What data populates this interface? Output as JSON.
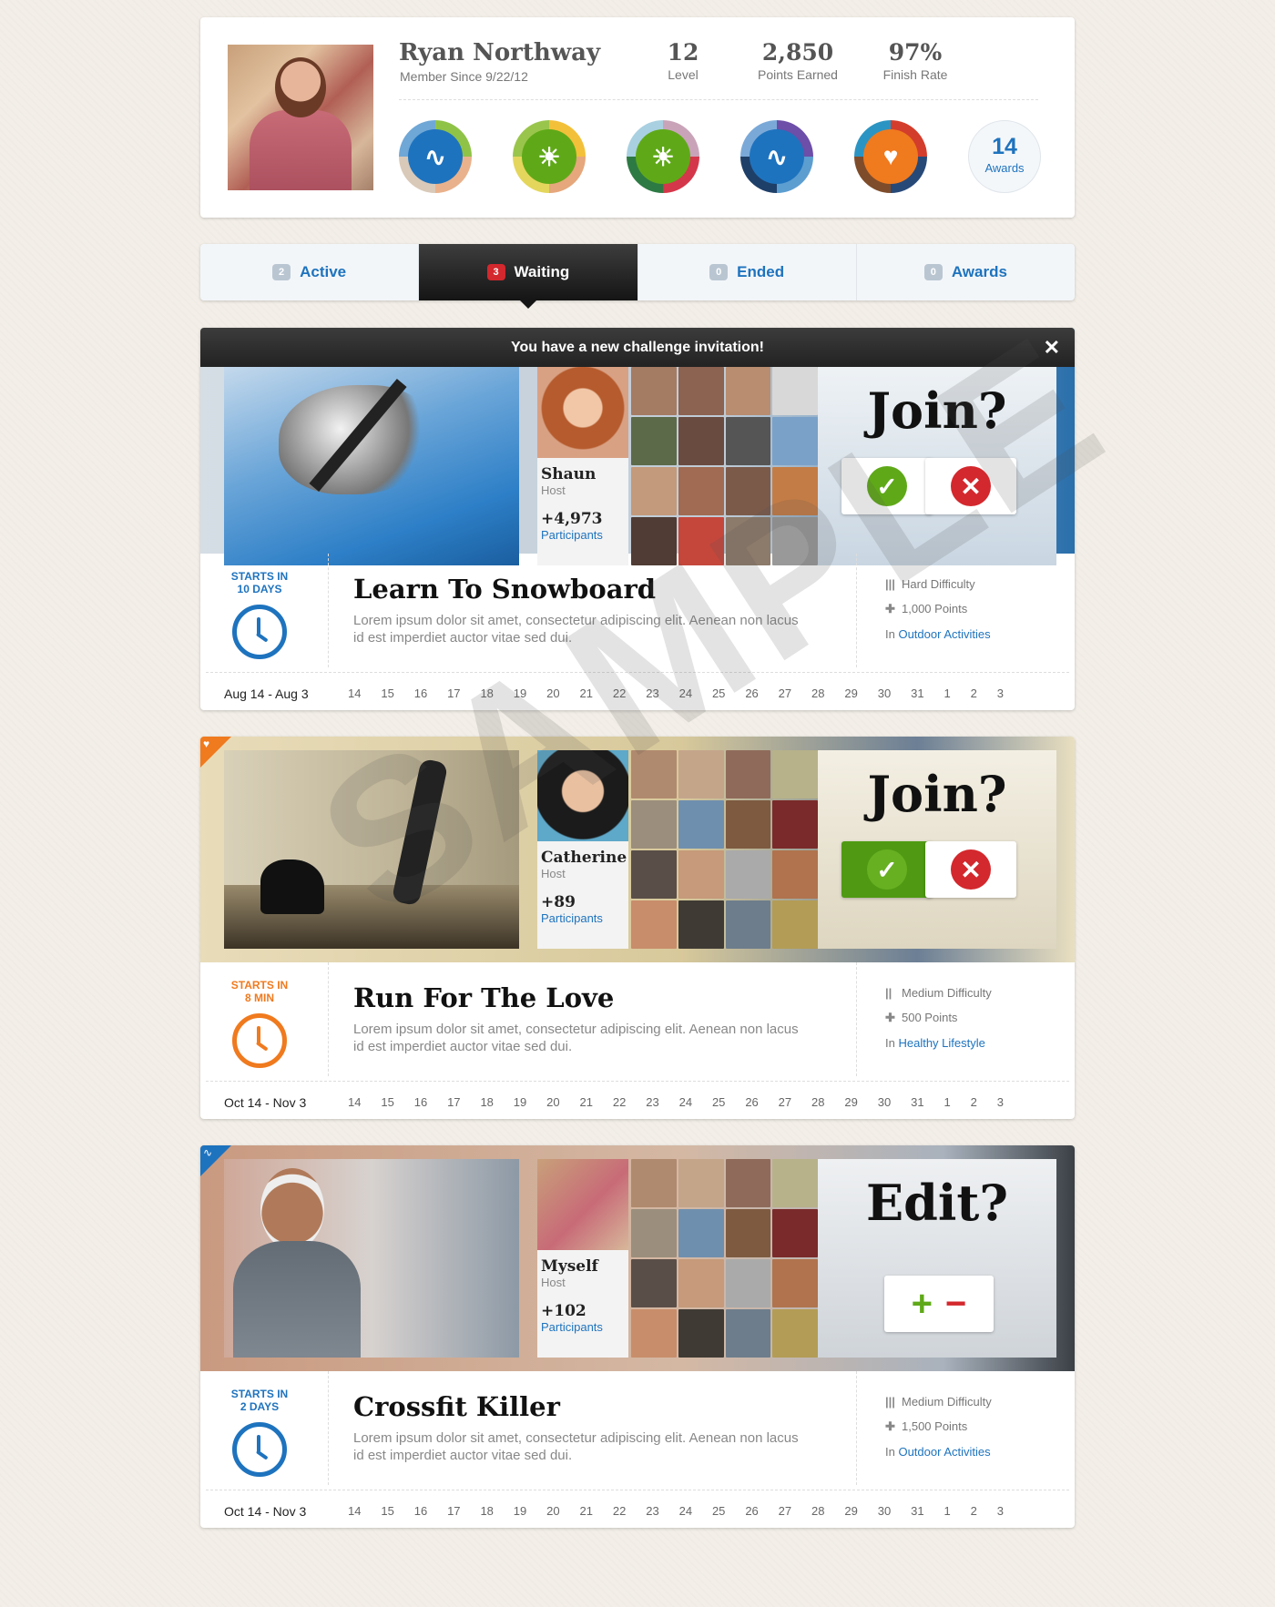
{
  "profile": {
    "name": "Ryan Northway",
    "member_since": "Member Since 9/22/12",
    "stats": [
      {
        "value": "12",
        "label": "Level"
      },
      {
        "value": "2,850",
        "label": "Points Earned"
      },
      {
        "value": "97%",
        "label": "Finish Rate"
      }
    ],
    "badges": [
      "pulse-icon",
      "sun-icon",
      "sun-icon",
      "pulse-icon",
      "heart-icon"
    ],
    "awards_count": "14",
    "awards_label": "Awards"
  },
  "tabs": [
    {
      "count": "2",
      "label": "Active"
    },
    {
      "count": "3",
      "label": "Waiting"
    },
    {
      "count": "0",
      "label": "Ended"
    },
    {
      "count": "0",
      "label": "Awards"
    }
  ],
  "challenges": [
    {
      "notice": "You have a new challenge invitation!",
      "host_name": "Shaun",
      "host_role": "Host",
      "participants_count": "+4,973",
      "participants_label": "Participants",
      "prompt": "Join?",
      "starts_label": "STARTS IN",
      "starts_value": "10 DAYS",
      "title": "Learn To Snowboard",
      "description": "Lorem ipsum dolor sit amet, consectetur adipiscing elit. Aenean non lacus id est imperdiet auctor vitae sed dui.",
      "difficulty": "Hard Difficulty",
      "points": "1,000 Points",
      "category_prefix": "In",
      "category": "Outdoor Activities",
      "date_range": "Aug 14 - Aug 3",
      "accent": "#1e73be"
    },
    {
      "host_name": "Catherine",
      "host_role": "Host",
      "participants_count": "+89",
      "participants_label": "Participants",
      "prompt": "Join?",
      "starts_label": "STARTS IN",
      "starts_value": "8 MIN",
      "title": "Run For The Love",
      "description": "Lorem ipsum dolor sit amet, consectetur adipiscing elit. Aenean non lacus id est imperdiet auctor vitae sed dui.",
      "difficulty": "Medium Difficulty",
      "points": "500 Points",
      "category_prefix": "In",
      "category": "Healthy Lifestyle",
      "date_range": "Oct 14 - Nov 3",
      "accent": "#f07a1e"
    },
    {
      "host_name": "Myself",
      "host_role": "Host",
      "participants_count": "+102",
      "participants_label": "Participants",
      "prompt": "Edit?",
      "starts_label": "STARTS IN",
      "starts_value": "2 DAYS",
      "title": "Crossfit Killer",
      "description": "Lorem ipsum dolor sit amet, consectetur adipiscing elit. Aenean non lacus id est imperdiet auctor vitae sed dui.",
      "difficulty": "Medium Difficulty",
      "points": "1,500 Points",
      "category_prefix": "In",
      "category": "Outdoor Activities",
      "date_range": "Oct 14 - Nov 3",
      "accent": "#1e73be"
    }
  ],
  "calendar_days": [
    "14",
    "15",
    "16",
    "17",
    "18",
    "19",
    "20",
    "21",
    "22",
    "23",
    "24",
    "25",
    "26",
    "27",
    "28",
    "29",
    "30",
    "31",
    "1",
    "2",
    "3"
  ],
  "watermark": "SAMPLE"
}
